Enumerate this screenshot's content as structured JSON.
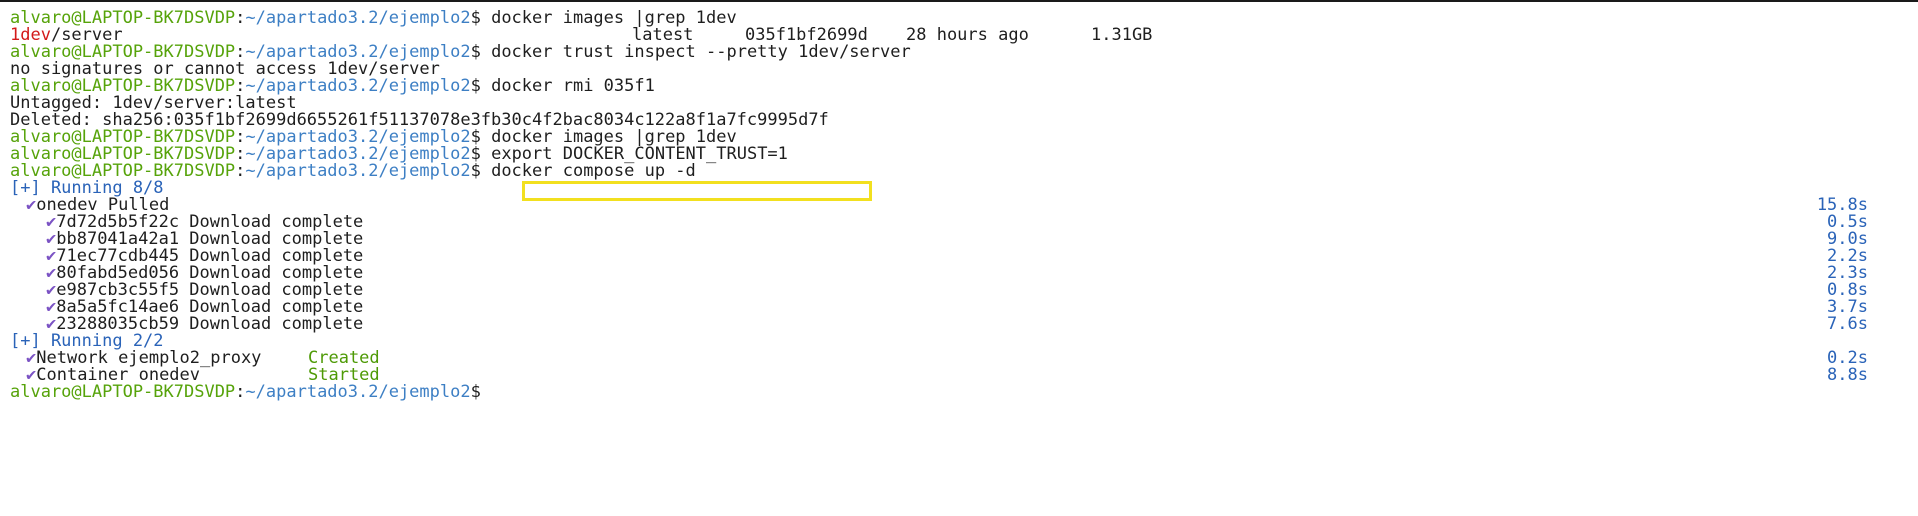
{
  "prompt": {
    "user": "alvaro@LAPTOP-BK7DSVDP",
    "sep": ":",
    "path": "~/apartado3.2/ejemplo2",
    "symbol": "$"
  },
  "lines": {
    "l0": {
      "cmd": " docker images |grep 1dev"
    },
    "l1": {
      "repo_red": "1dev",
      "repo_rest": "/server",
      "tag": "latest",
      "image_id": "035f1bf2699d",
      "created": "28 hours ago",
      "size": "1.31GB"
    },
    "l2": {
      "cmd": " docker trust inspect --pretty 1dev/server"
    },
    "l3": {
      "text": "no signatures or cannot access 1dev/server"
    },
    "l4": {
      "cmd": " docker rmi 035f1"
    },
    "l5": {
      "text": "Untagged: 1dev/server:latest"
    },
    "l6": {
      "text": "Deleted: sha256:035f1bf2699d6655261f51137078e3fb30c4f2bac8034c122a8f1a7fc9995d7f"
    },
    "l7": {
      "cmd": " docker images |grep 1dev"
    },
    "l8": {
      "cmd": "export DOCKER_CONTENT_TRUST=1"
    },
    "l9": {
      "cmd": " docker compose up -d"
    },
    "l10": {
      "text": "[+] Running 8/8"
    },
    "l11": {
      "check": "✔",
      "text": "onedev Pulled",
      "time": "15.8s"
    },
    "l12": {
      "check": "✔",
      "text": "7d72d5b5f22c Download complete",
      "time": "0.5s"
    },
    "l13": {
      "check": "✔",
      "text": "bb87041a42a1 Download complete",
      "time": "9.0s"
    },
    "l14": {
      "check": "✔",
      "text": "71ec77cdb445 Download complete",
      "time": "2.2s"
    },
    "l15": {
      "check": "✔",
      "text": "80fabd5ed056 Download complete",
      "time": "2.3s"
    },
    "l16": {
      "check": "✔",
      "text": "e987cb3c55f5 Download complete",
      "time": "0.8s"
    },
    "l17": {
      "check": "✔",
      "text": "8a5a5fc14ae6 Download complete",
      "time": "3.7s"
    },
    "l18": {
      "check": "✔",
      "text": "23288035cb59 Download complete",
      "time": "7.6s"
    },
    "l19": {
      "text": "[+] Running 2/2"
    },
    "l20": {
      "check": "✔",
      "text": "Network ejemplo2_proxy",
      "status": "Created",
      "time": "0.2s"
    },
    "l21": {
      "check": "✔",
      "text": "Container onedev",
      "status": "Started",
      "time": "8.8s"
    }
  },
  "colors": {
    "user": "#56a30a",
    "path": "#3d7fc4",
    "red": "#d31a1a",
    "blue": "#2a63b8",
    "green": "#4e9a06",
    "check": "#7b53c4",
    "highlight": "#f2e01f"
  },
  "icons": {
    "check": "check-icon"
  }
}
